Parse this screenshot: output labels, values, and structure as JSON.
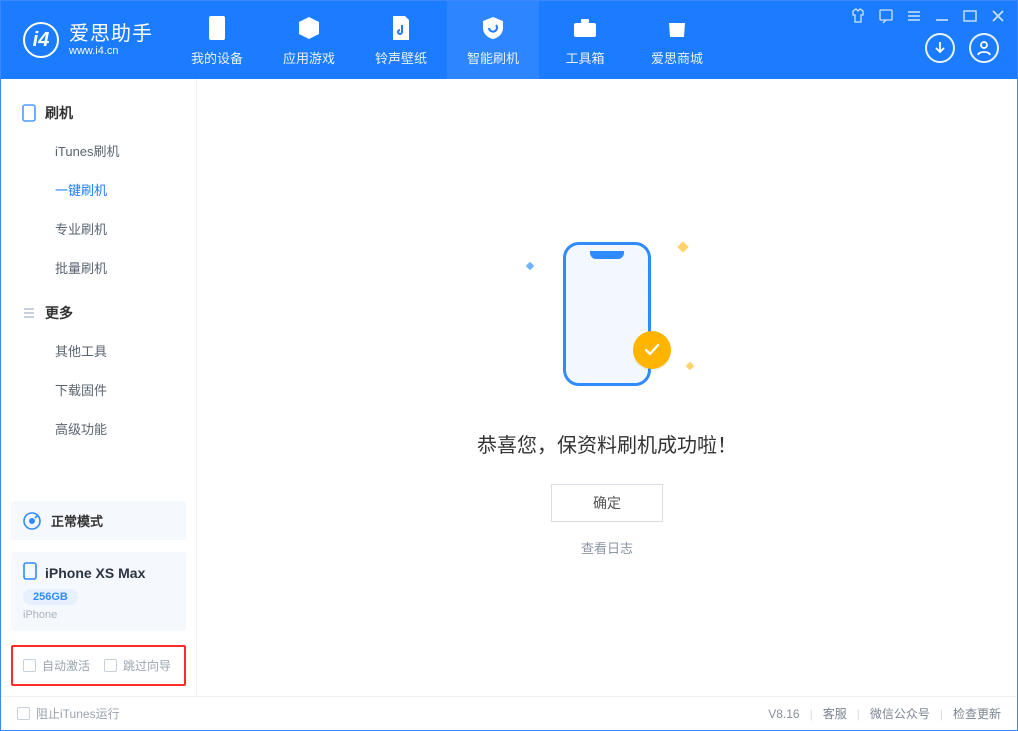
{
  "brand": {
    "name": "爱思助手",
    "url": "www.i4.cn"
  },
  "nav": {
    "device": "我的设备",
    "apps": "应用游戏",
    "ring": "铃声壁纸",
    "flash": "智能刷机",
    "tools": "工具箱",
    "mall": "爱思商城"
  },
  "sidebar": {
    "group1": {
      "title": "刷机",
      "items": {
        "itunes": "iTunes刷机",
        "onekey": "一键刷机",
        "pro": "专业刷机",
        "batch": "批量刷机"
      }
    },
    "group2": {
      "title": "更多",
      "items": {
        "other": "其他工具",
        "firmware": "下载固件",
        "advanced": "高级功能"
      }
    },
    "status": {
      "label": "正常模式"
    },
    "device": {
      "name": "iPhone XS Max",
      "storage": "256GB",
      "type": "iPhone"
    },
    "options": {
      "auto_activate": "自动激活",
      "skip_wizard": "跳过向导"
    }
  },
  "main": {
    "headline": "恭喜您，保资料刷机成功啦！",
    "ok": "确定",
    "view_log": "查看日志"
  },
  "footer": {
    "block_itunes": "阻止iTunes运行",
    "version": "V8.16",
    "service": "客服",
    "wechat": "微信公众号",
    "update": "检查更新"
  }
}
